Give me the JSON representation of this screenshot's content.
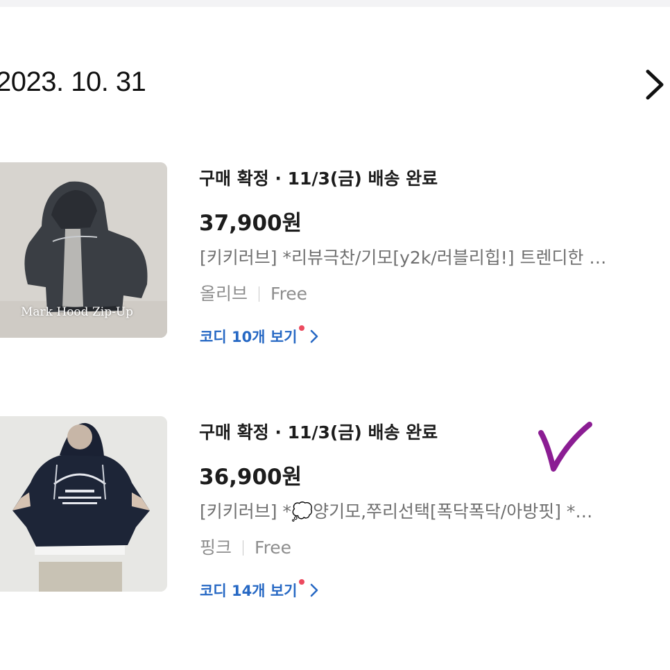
{
  "order_date": "2023. 10. 31",
  "accent_colors": {
    "link": "#2668c4",
    "notification_dot": "#ec4a5f",
    "checkmark": "#8b1d93"
  },
  "items": [
    {
      "status": "구매 확정 · 11/3(금) 배송 완료",
      "price": "37,900원",
      "product_name": "[키키러브] *리뷰극찬/기모[y2k/러블리힙!] 트렌디한 …",
      "option_color": "올리브",
      "option_size": "Free",
      "coordi_link": "코디 10개 보기",
      "image_caption": "Mark Hood Zip-Up"
    },
    {
      "status": "구매 확정 · 11/3(금) 배송 완료",
      "price": "36,900원",
      "product_name": "[키키러브] *💭양기모,쭈리선택[폭닥폭닥/아방핏] *…",
      "option_color": "핑크",
      "option_size": "Free",
      "coordi_link": "코디 14개 보기",
      "image_caption": ""
    }
  ]
}
